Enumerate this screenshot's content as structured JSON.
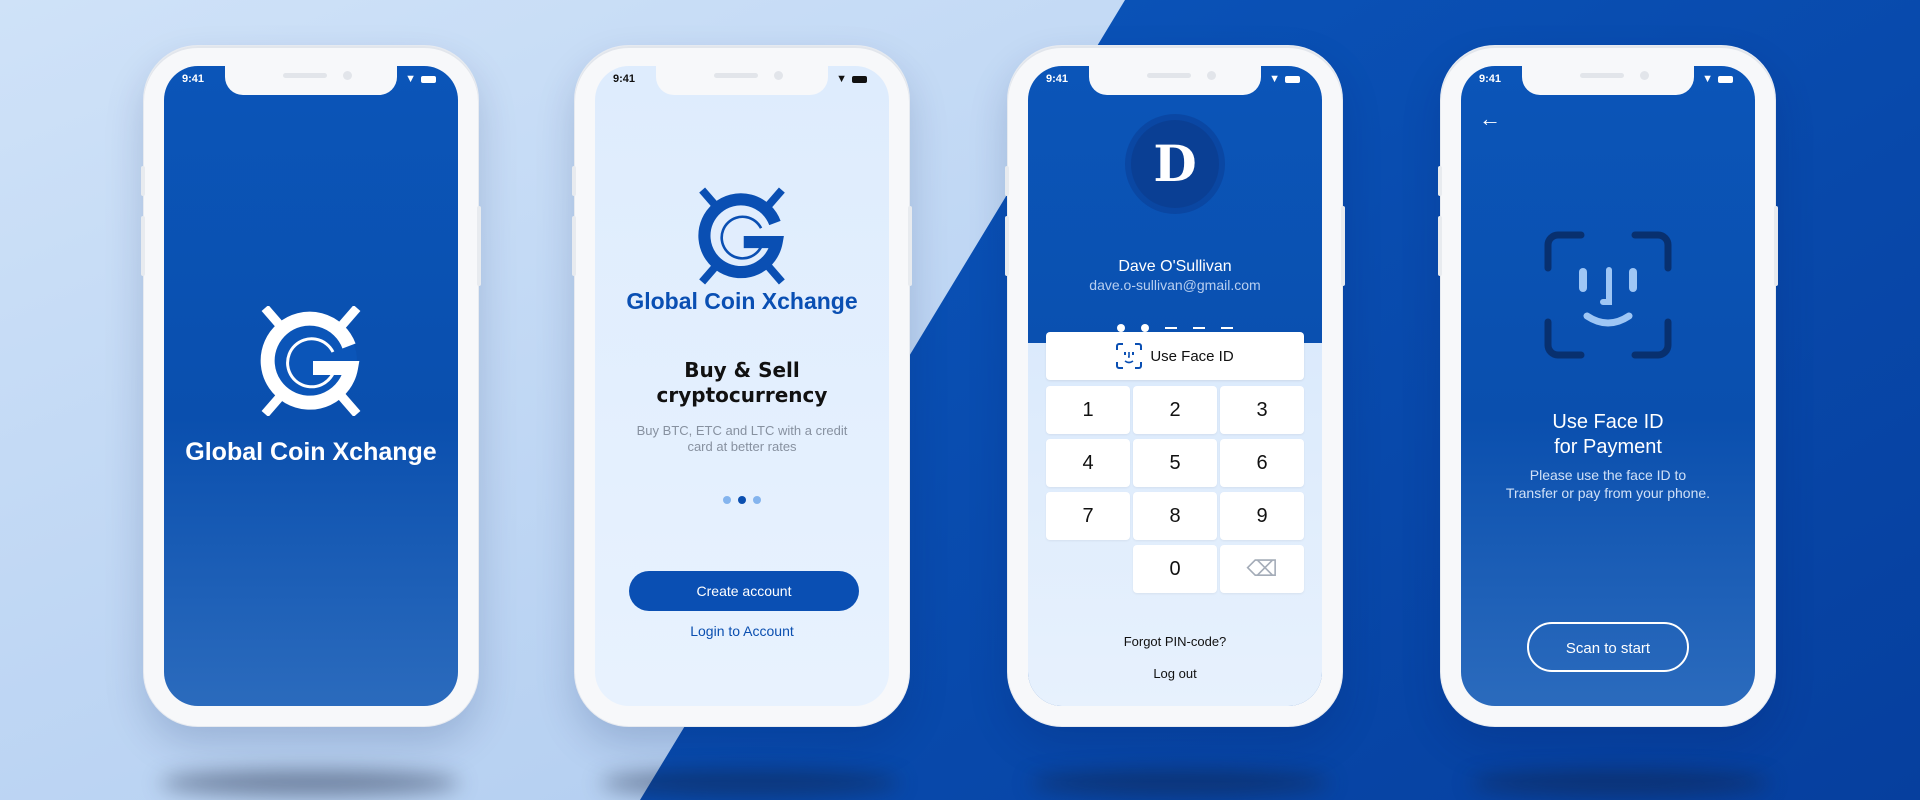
{
  "status_bar": {
    "time": "9:41"
  },
  "brand": {
    "name": "Global Coin Xchange"
  },
  "splash": {},
  "onboarding": {
    "title_line1": "Buy & Sell",
    "title_line2": "cryptocurrency",
    "subtitle_line1": "Buy BTC, ETC and LTC with a credit",
    "subtitle_line2": "card at better rates",
    "pager": {
      "count": 3,
      "active": 2
    },
    "create_account_label": "Create account",
    "login_label": "Login to Account"
  },
  "pin_screen": {
    "avatar_letter": "D",
    "user_name": "Dave O'Sullivan",
    "user_email": "dave.o-sullivan@gmail.com",
    "pin_entered": 2,
    "pin_length": 5,
    "face_id_label": "Use Face ID",
    "keys": [
      "1",
      "2",
      "3",
      "4",
      "5",
      "6",
      "7",
      "8",
      "9",
      "0"
    ],
    "delete_icon": "backspace-icon",
    "forgot_label": "Forgot PIN-code?",
    "logout_label": "Log out"
  },
  "face_id_screen": {
    "back_icon": "arrow-left-icon",
    "title_line1": "Use Face ID",
    "title_line2": "for Payment",
    "subtitle_line1": "Please use the face ID to",
    "subtitle_line2": "Transfer or pay from your phone.",
    "scan_label": "Scan to start"
  },
  "colors": {
    "brand_blue": "#0a4fb3",
    "light_bg": "#deecfd",
    "accent_light": "#84b4ee"
  }
}
